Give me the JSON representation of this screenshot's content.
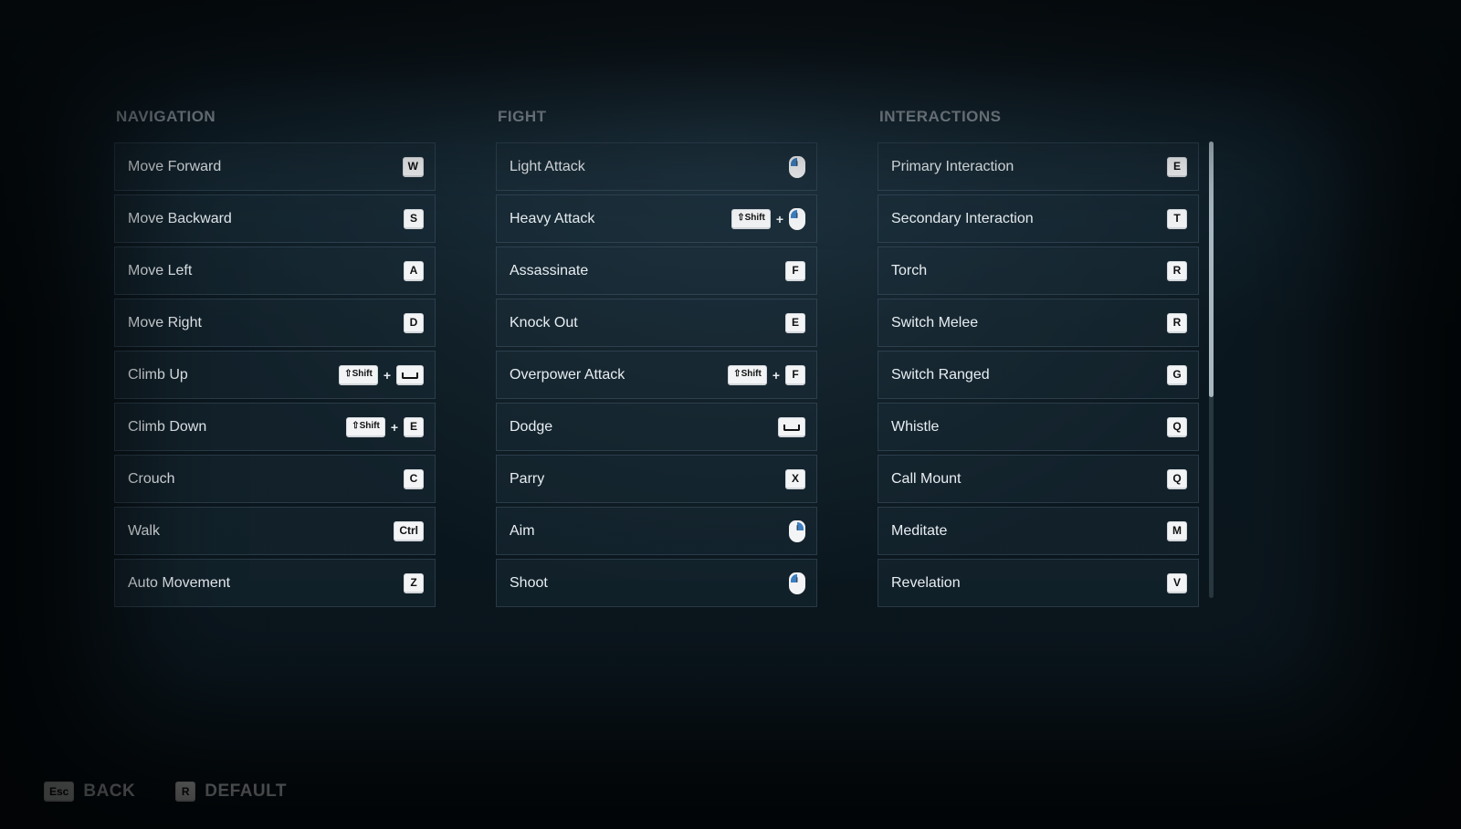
{
  "columns": [
    {
      "id": "navigation",
      "heading": "NAVIGATION",
      "rows": [
        {
          "id": "move-forward",
          "label": "Move Forward",
          "keys": [
            {
              "type": "key",
              "text": "W"
            }
          ]
        },
        {
          "id": "move-backward",
          "label": "Move Backward",
          "keys": [
            {
              "type": "key",
              "text": "S"
            }
          ]
        },
        {
          "id": "move-left",
          "label": "Move Left",
          "keys": [
            {
              "type": "key",
              "text": "A"
            }
          ]
        },
        {
          "id": "move-right",
          "label": "Move Right",
          "keys": [
            {
              "type": "key",
              "text": "D"
            }
          ]
        },
        {
          "id": "climb-up",
          "label": "Climb Up",
          "keys": [
            {
              "type": "shift"
            },
            {
              "type": "plus"
            },
            {
              "type": "space"
            }
          ]
        },
        {
          "id": "climb-down",
          "label": "Climb Down",
          "keys": [
            {
              "type": "shift"
            },
            {
              "type": "plus"
            },
            {
              "type": "key",
              "text": "E"
            }
          ]
        },
        {
          "id": "crouch",
          "label": "Crouch",
          "keys": [
            {
              "type": "key",
              "text": "C"
            }
          ]
        },
        {
          "id": "walk",
          "label": "Walk",
          "keys": [
            {
              "type": "key",
              "text": "Ctrl"
            }
          ]
        },
        {
          "id": "auto-movement",
          "label": "Auto Movement",
          "keys": [
            {
              "type": "key",
              "text": "Z"
            }
          ]
        }
      ]
    },
    {
      "id": "fight",
      "heading": "FIGHT",
      "rows": [
        {
          "id": "light-attack",
          "label": "Light Attack",
          "keys": [
            {
              "type": "mouse",
              "button": "left"
            }
          ]
        },
        {
          "id": "heavy-attack",
          "label": "Heavy Attack",
          "keys": [
            {
              "type": "shift"
            },
            {
              "type": "plus"
            },
            {
              "type": "mouse",
              "button": "left"
            }
          ]
        },
        {
          "id": "assassinate",
          "label": "Assassinate",
          "keys": [
            {
              "type": "key",
              "text": "F"
            }
          ]
        },
        {
          "id": "knock-out",
          "label": "Knock Out",
          "keys": [
            {
              "type": "key",
              "text": "E"
            }
          ]
        },
        {
          "id": "overpower-attack",
          "label": "Overpower Attack",
          "keys": [
            {
              "type": "shift"
            },
            {
              "type": "plus"
            },
            {
              "type": "key",
              "text": "F"
            }
          ]
        },
        {
          "id": "dodge",
          "label": "Dodge",
          "keys": [
            {
              "type": "space"
            }
          ]
        },
        {
          "id": "parry",
          "label": "Parry",
          "keys": [
            {
              "type": "key",
              "text": "X"
            }
          ]
        },
        {
          "id": "aim",
          "label": "Aim",
          "keys": [
            {
              "type": "mouse",
              "button": "right"
            }
          ]
        },
        {
          "id": "shoot",
          "label": "Shoot",
          "keys": [
            {
              "type": "mouse",
              "button": "left"
            }
          ]
        }
      ]
    },
    {
      "id": "interactions",
      "heading": "INTERACTIONS",
      "rows": [
        {
          "id": "primary-interaction",
          "label": "Primary Interaction",
          "keys": [
            {
              "type": "key",
              "text": "E"
            }
          ]
        },
        {
          "id": "secondary-interaction",
          "label": "Secondary Interaction",
          "keys": [
            {
              "type": "key",
              "text": "T"
            }
          ]
        },
        {
          "id": "torch",
          "label": "Torch",
          "keys": [
            {
              "type": "key",
              "text": "R"
            }
          ]
        },
        {
          "id": "switch-melee",
          "label": "Switch Melee",
          "keys": [
            {
              "type": "key",
              "text": "R"
            }
          ]
        },
        {
          "id": "switch-ranged",
          "label": "Switch Ranged",
          "keys": [
            {
              "type": "key",
              "text": "G"
            }
          ]
        },
        {
          "id": "whistle",
          "label": "Whistle",
          "keys": [
            {
              "type": "key",
              "text": "Q"
            }
          ]
        },
        {
          "id": "call-mount",
          "label": "Call Mount",
          "keys": [
            {
              "type": "key",
              "text": "Q"
            }
          ]
        },
        {
          "id": "meditate",
          "label": "Meditate",
          "keys": [
            {
              "type": "key",
              "text": "M"
            }
          ]
        },
        {
          "id": "revelation",
          "label": "Revelation",
          "keys": [
            {
              "type": "key",
              "text": "V"
            }
          ]
        }
      ]
    }
  ],
  "footer": {
    "back": {
      "key": "Esc",
      "label": "BACK"
    },
    "default": {
      "key": "R",
      "label": "DEFAULT"
    }
  },
  "shift_text": "⇧Shift"
}
